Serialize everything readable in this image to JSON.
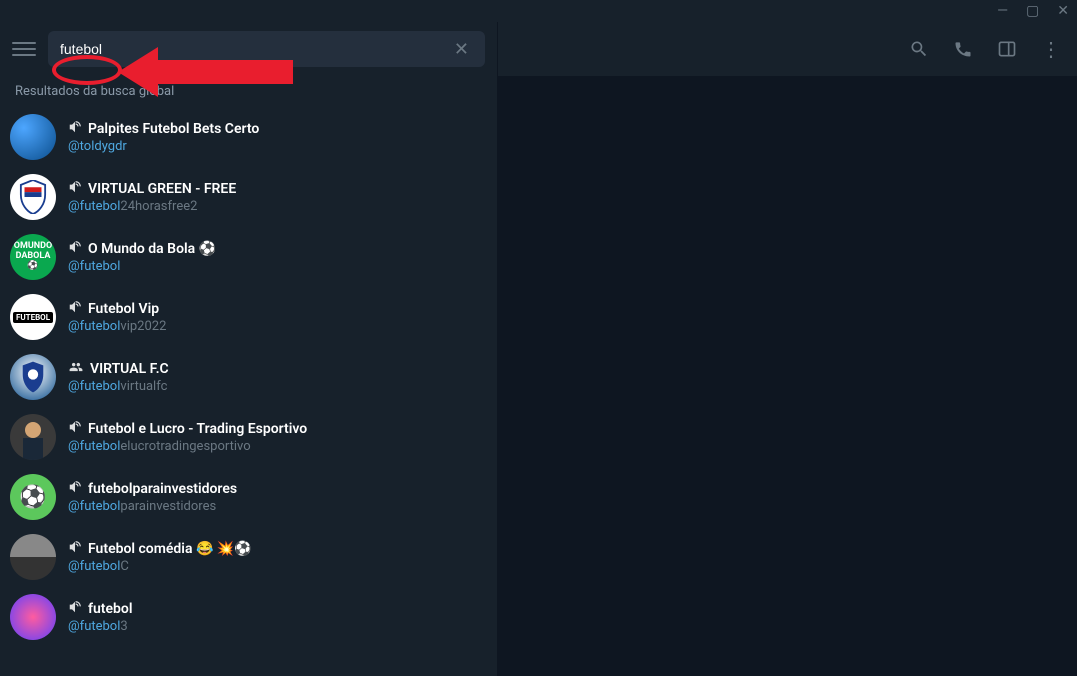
{
  "search": {
    "value": "futebol",
    "placeholder": ""
  },
  "sectionHeader": "Resultados da busca global",
  "results": [
    {
      "iconType": "megaphone",
      "title": "Palpites Futebol Bets Certo",
      "handleHighlight": "@toldygdr",
      "handleRest": "",
      "avatarClass": "av-1"
    },
    {
      "iconType": "megaphone",
      "title": "VIRTUAL GREEN - FREE",
      "handleHighlight": "@futebol",
      "handleRest": "24horasfree2",
      "avatarClass": "av-2"
    },
    {
      "iconType": "megaphone",
      "title": "O Mundo da Bola ⚽",
      "handleHighlight": "@futebol",
      "handleRest": "",
      "avatarClass": "av-3"
    },
    {
      "iconType": "megaphone",
      "title": "Futebol Vip",
      "handleHighlight": "@futebol",
      "handleRest": "vip2022",
      "avatarClass": "av-4"
    },
    {
      "iconType": "group",
      "title": "VIRTUAL F.C",
      "handleHighlight": "@futebol",
      "handleRest": "virtualfc",
      "avatarClass": "av-5"
    },
    {
      "iconType": "megaphone",
      "title": "Futebol e Lucro - Trading Esportivo",
      "handleHighlight": "@futebol",
      "handleRest": "elucrotradingesportivo",
      "avatarClass": "av-6"
    },
    {
      "iconType": "megaphone",
      "title": "futebolparainvestidores",
      "handleHighlight": "@futebol",
      "handleRest": "parainvestidores",
      "avatarClass": "av-7"
    },
    {
      "iconType": "megaphone",
      "title": "Futebol comédia 😂 💥⚽",
      "handleHighlight": "@futebol",
      "handleRest": "C",
      "avatarClass": "av-8"
    },
    {
      "iconType": "megaphone",
      "title": "futebol",
      "handleHighlight": "@futebol",
      "handleRest": "3",
      "avatarClass": "av-9"
    }
  ],
  "avatarTexts": {
    "2": "OMUNDO DABOLA",
    "3": "FUTEBOL"
  }
}
